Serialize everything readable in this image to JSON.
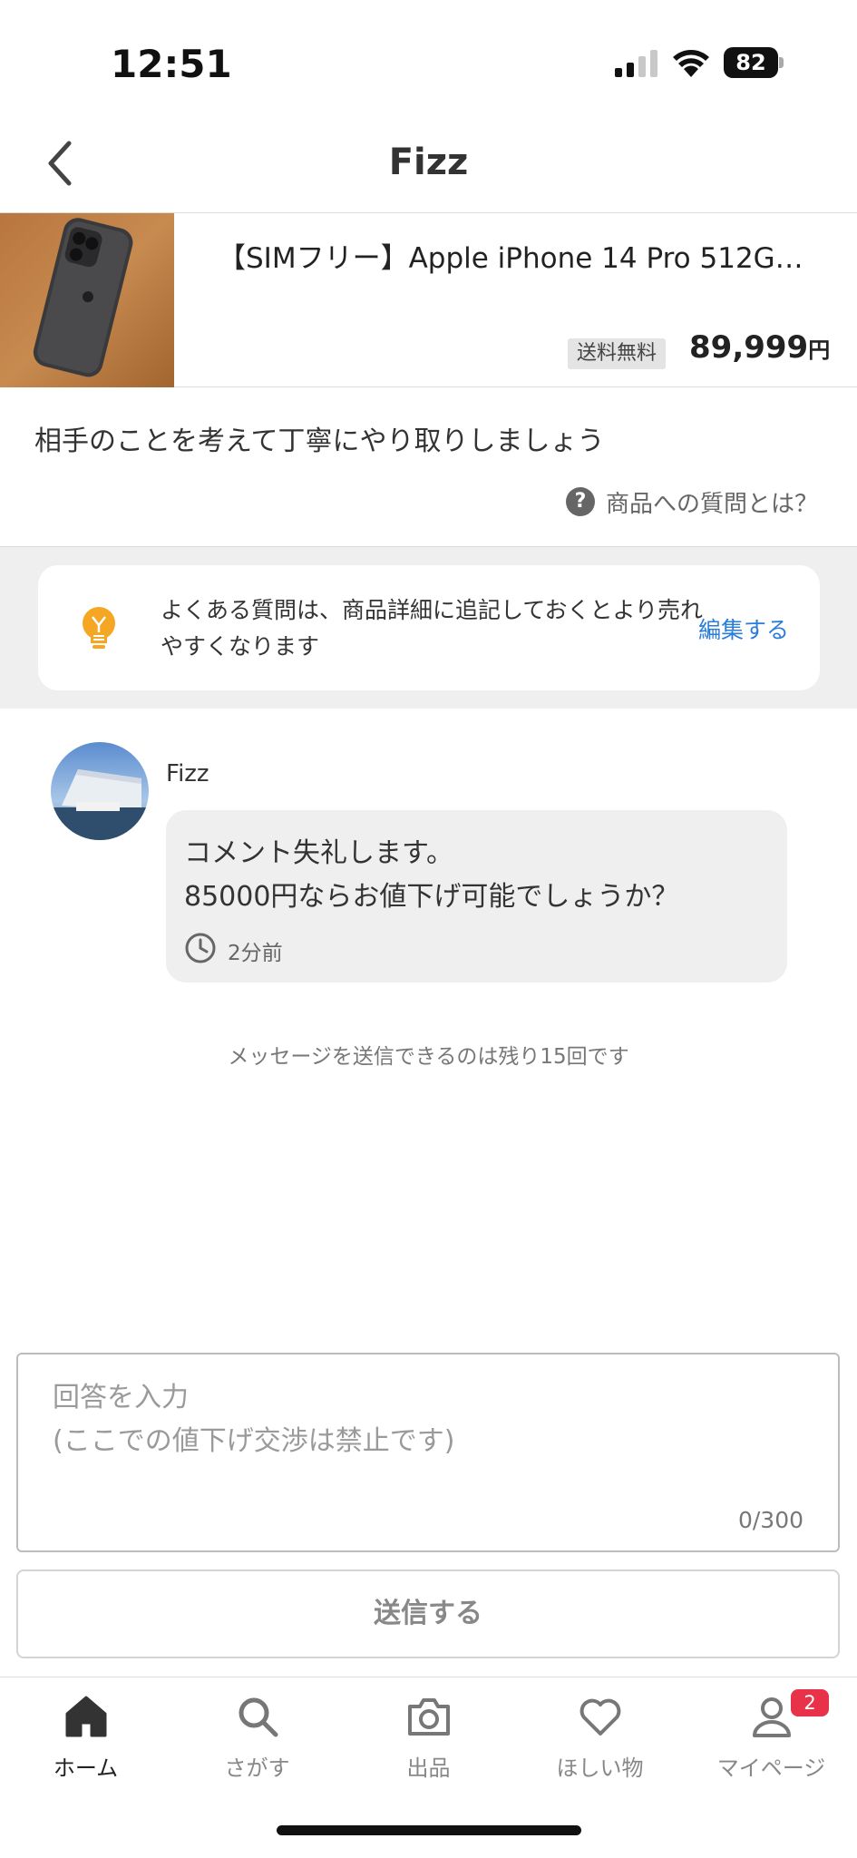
{
  "status_bar": {
    "time": "12:51",
    "battery": "82"
  },
  "header": {
    "title": "Fizz"
  },
  "product": {
    "title": "【SIMフリー】Apple iPhone 14 Pro 512G…",
    "shipping_badge": "送料無料",
    "price": "89,999",
    "currency": "円"
  },
  "guideline": {
    "text": "相手のことを考えて丁寧にやり取りしましょう",
    "question_link": "商品への質問とは？"
  },
  "tip": {
    "text": "よくある質問は、商品詳細に追記しておくとより売れやすくなります",
    "edit_label": "編集する"
  },
  "comment": {
    "author": "Fizz",
    "line1": "コメント失礼します。",
    "line2": "85000円ならお値下げ可能でしょうか？",
    "time_ago": "2分前"
  },
  "remaining_notice": "メッセージを送信できるのは残り15回です",
  "answer": {
    "placeholder_line1": "回答を入力",
    "placeholder_line2": "(ここでの値下げ交渉は禁止です)",
    "counter": "0/300"
  },
  "send_label": "送信する",
  "tabbar": {
    "items": [
      {
        "label": "ホーム",
        "icon": "home-icon"
      },
      {
        "label": "さがす",
        "icon": "search-icon"
      },
      {
        "label": "出品",
        "icon": "camera-icon"
      },
      {
        "label": "ほしい物",
        "icon": "heart-icon"
      },
      {
        "label": "マイページ",
        "icon": "person-icon"
      }
    ],
    "mypage_badge": "2"
  },
  "colors": {
    "link": "#2a7dd8",
    "badge": "#e8324a",
    "bulb": "#f5a623"
  }
}
